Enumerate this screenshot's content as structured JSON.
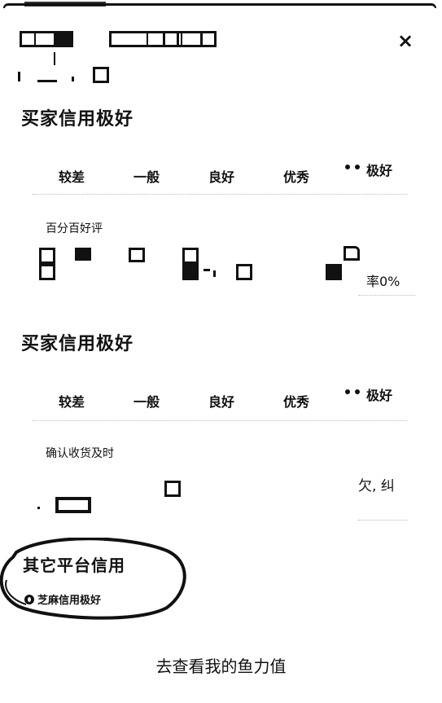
{
  "header": {
    "close_symbol": "×"
  },
  "section1": {
    "title": "买家信用极好",
    "scale": [
      "较差",
      "一般",
      "良好",
      "优秀",
      "极好"
    ],
    "caption": "百分百好评",
    "rate_text": "率0%"
  },
  "section2": {
    "title": "买家信用极好",
    "scale": [
      "较差",
      "一般",
      "良好",
      "优秀",
      "极好"
    ],
    "caption": "确认收货及时",
    "right_text": "欠, 纠"
  },
  "section3": {
    "title": "其它平台信用",
    "zhima_label": "芝麻信用极好"
  },
  "cta_label": "去查看我的鱼力值",
  "icons": {
    "close": "close-icon",
    "face": "face-icon",
    "zhima": "zhima-icon"
  }
}
